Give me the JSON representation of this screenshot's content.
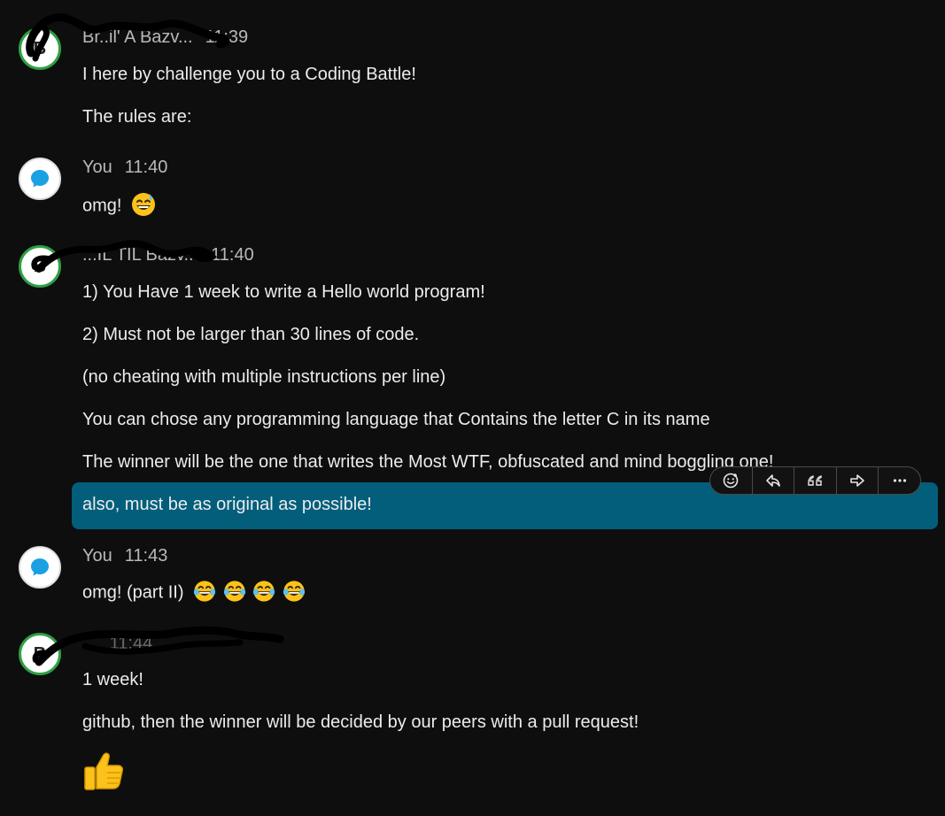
{
  "messages": {
    "g1": {
      "sender": "Br..il' A Bazv...",
      "time": "11:39",
      "lines": [
        "I here by challenge you to a Coding Battle!",
        "The rules are:"
      ]
    },
    "g2": {
      "sender": "You",
      "time": "11:40",
      "text": "omg!"
    },
    "g3": {
      "sender": "...IL TIL Bazv...",
      "time": "11:40",
      "lines": [
        "1) You Have 1 week to write a Hello world program!",
        "2) Must not be larger than 30 lines of code.",
        "(no cheating with multiple instructions per line)",
        "You can chose any programming language that Contains the letter C in its name",
        "The winner will be the one that writes the Most WTF, obfuscated and mind boggling one!",
        "also, must be as original as possible!"
      ]
    },
    "g4": {
      "sender": "You",
      "time": "11:43",
      "text": "omg! (part II)"
    },
    "g5": {
      "sender": "...",
      "time": "11:44",
      "lines": [
        "1 week!",
        "github, then the winner will be decided by our peers with a pull  request!"
      ]
    }
  },
  "toolbar": {
    "icons": [
      "add-reaction-icon",
      "reply-icon",
      "quote-icon",
      "forward-icon",
      "more-icon"
    ]
  },
  "colors": {
    "background": "#0e0e0f",
    "highlight": "#035e7b",
    "avatar_ring": "#2ea043",
    "you_icon": "#1ba1e2"
  }
}
